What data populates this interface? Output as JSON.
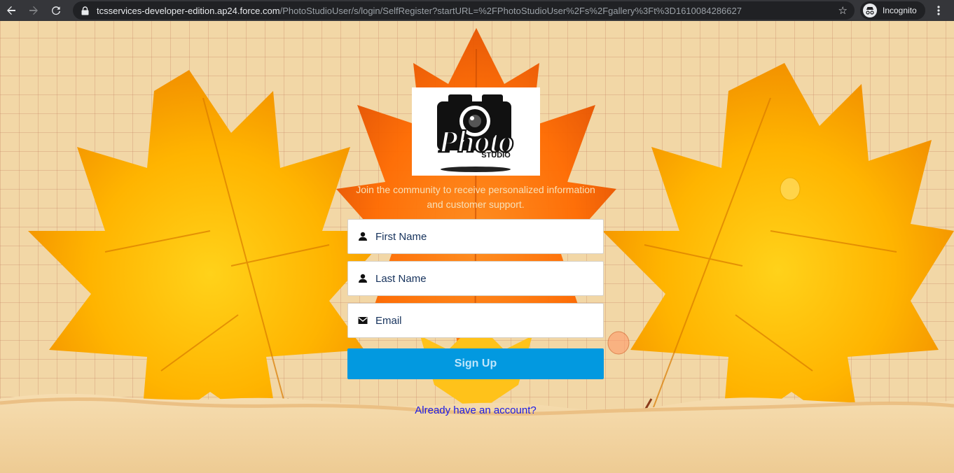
{
  "browser": {
    "url_host": "tcsservices-developer-edition.ap24.force.com",
    "url_path": "/PhotoStudioUser/s/login/SelfRegister?startURL=%2FPhotoStudioUser%2Fs%2Fgallery%3Ft%3D1610084286627",
    "incognito_label": "Incognito"
  },
  "logo": {
    "main_text": "Photo",
    "sub_text": "STUDIO"
  },
  "register": {
    "tagline": "Join the community to receive personalized information and customer support.",
    "first_name_placeholder": "First Name",
    "last_name_placeholder": "Last Name",
    "email_placeholder": "Email",
    "signup_label": "Sign Up",
    "login_link": "Already have an account?"
  },
  "colors": {
    "button": "#0299e0",
    "link": "#1a1ae6",
    "chrome": "#35363a"
  }
}
